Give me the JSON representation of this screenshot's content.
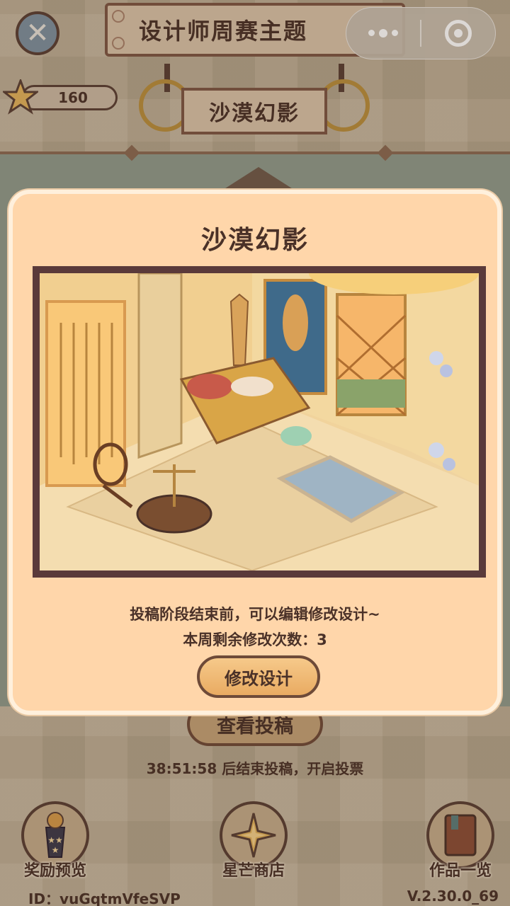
{
  "header": {
    "title": "设计师周赛主题",
    "theme_name": "沙漠幻影",
    "star_count": "160"
  },
  "capsule": {
    "more_icon": "more-dots-icon",
    "close_icon": "target-icon"
  },
  "modal": {
    "title": "沙漠幻影",
    "description": "投稿阶段结束前，可以编辑修改设计~",
    "remaining_edits": "本周剩余修改次数：3",
    "edit_button": "修改设计",
    "preview_alt": "desert themed isometric room design"
  },
  "background": {
    "view_submissions_button": "查看投稿",
    "countdown_text": "38:51:58 后结束投稿，开启投票"
  },
  "bottom_nav": [
    {
      "label": "奖励预览",
      "icon": "trophy-icon"
    },
    {
      "label": "星芒商店",
      "icon": "compass-star-icon"
    },
    {
      "label": "作品一览",
      "icon": "book-icon"
    }
  ],
  "footer": {
    "user_id": "ID：vuGqtmVfeSVP",
    "version": "V.2.30.0_69"
  },
  "colors": {
    "modal_bg": "#ffd6aa",
    "text_dark": "#4a3128",
    "border_brown": "#6e4a38"
  }
}
